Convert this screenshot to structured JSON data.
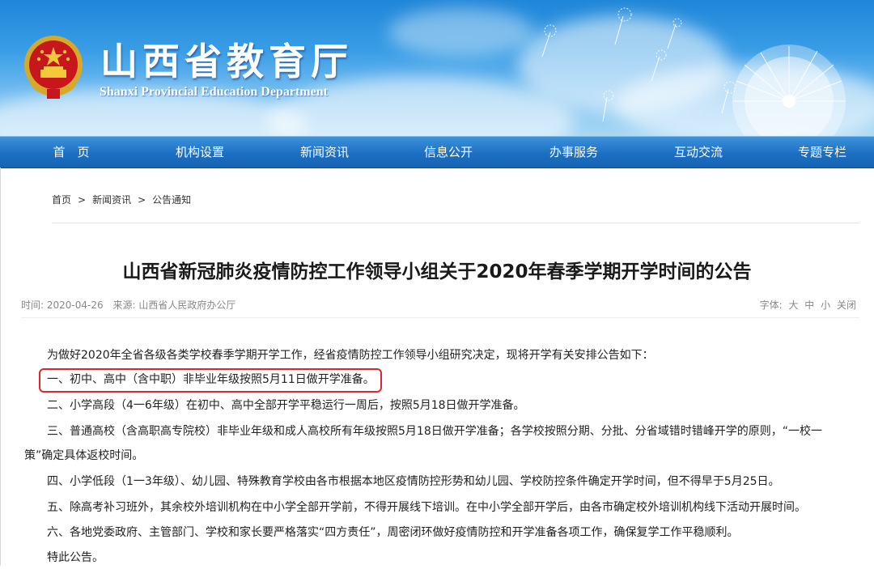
{
  "header": {
    "title_cn": "山西省教育厅",
    "title_en": "Shanxi Provincial Education Department",
    "emblem_icon": "national-emblem-icon"
  },
  "nav": {
    "items": [
      "首　页",
      "机构设置",
      "新闻资讯",
      "信息公开",
      "办事服务",
      "互动交流",
      "专题专栏"
    ]
  },
  "breadcrumb": [
    "首页",
    "新闻资讯",
    "公告通知"
  ],
  "breadcrumb_sep": ">",
  "article": {
    "title": "山西省新冠肺炎疫情防控工作领导小组关于2020年春季学期开学时间的公告",
    "time_label": "时间:",
    "time": "2020-04-26",
    "source_label": "来源:",
    "source": "山西省人民政府办公厅",
    "font_label": "字体:",
    "font_large": "大",
    "font_medium": "中",
    "font_small": "小",
    "close": "关闭",
    "paragraphs": [
      "为做好2020年全省各级各类学校春季学期开学工作，经省疫情防控工作领导小组研究决定，现将开学有关安排公告如下：",
      "一、初中、高中（含中职）非毕业年级按照5月11日做开学准备。",
      "二、小学高段（4一6年级）在初中、高中全部开学平稳运行一周后，按照5月18日做开学准备。",
      "三、普通高校（含高职高专院校）非毕业年级和成人高校所有年级按照5月18日做开学准备；各学校按照分期、分批、分省域错时错峰开学的原则，“一校一",
      "策”确定具体返校时间。",
      "四、小学低段（1一3年级）、幼儿园、特殊教育学校由各市根据本地区疫情防控形势和幼儿园、学校防控条件确定开学时间，但不得早于5月25日。",
      "五、除高考补习班外，其余校外培训机构在中小学全部开学前，不得开展线下培训。在中小学全部开学后，由各市确定校外培训机构线下活动开展时间。",
      "六、各地党委政府、主管部门、学校和家长要严格落实“四方责任”，周密闭环做好疫情防控和开学准备各项工作，确保复学工作平稳顺利。",
      "特此公告。"
    ]
  },
  "colors": {
    "nav_bg": "#1d6fc2",
    "highlight_box": "#e0262b",
    "banner_sky": "#3a9ee6"
  }
}
